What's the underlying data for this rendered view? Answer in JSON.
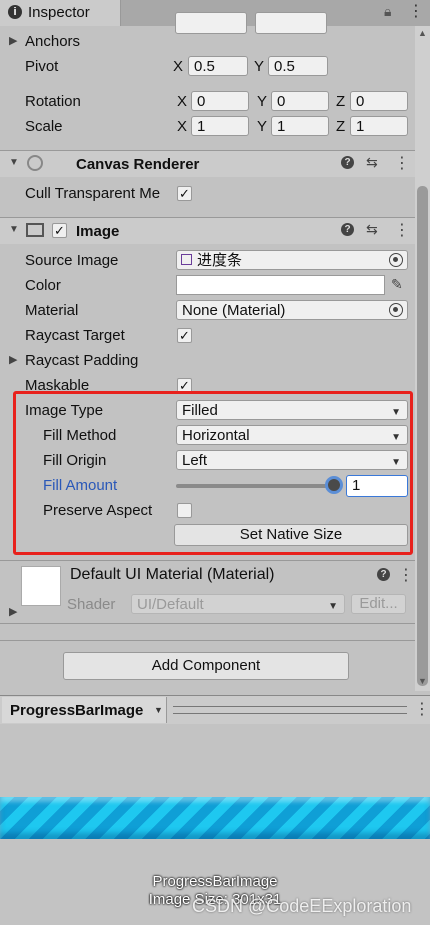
{
  "tab": {
    "title": "Inspector",
    "icons": [
      "lock-icon",
      "menu-icon"
    ]
  },
  "transform": {
    "anchors_label": "Anchors",
    "pivot_label": "Pivot",
    "pivot_x": "0.5",
    "pivot_y": "0.5",
    "rotation_label": "Rotation",
    "rot_x": "0",
    "rot_y": "0",
    "rot_z": "0",
    "scale_label": "Scale",
    "scale_x": "1",
    "scale_y": "1",
    "scale_z": "1",
    "x": "X",
    "y": "Y",
    "z": "Z"
  },
  "canvas_renderer": {
    "title": "Canvas Renderer",
    "cull_label": "Cull Transparent Me",
    "cull_checked": true
  },
  "image": {
    "title": "Image",
    "enabled": true,
    "source_image_label": "Source Image",
    "source_image_value": "进度条",
    "color_label": "Color",
    "material_label": "Material",
    "material_value": "None (Material)",
    "raycast_target_label": "Raycast Target",
    "raycast_padding_label": "Raycast Padding",
    "maskable_label": "Maskable",
    "image_type_label": "Image Type",
    "image_type_value": "Filled",
    "fill_method_label": "Fill Method",
    "fill_method_value": "Horizontal",
    "fill_origin_label": "Fill Origin",
    "fill_origin_value": "Left",
    "fill_amount_label": "Fill Amount",
    "fill_amount_value": "1",
    "fill_amount_fraction": 1.0,
    "preserve_aspect_label": "Preserve Aspect",
    "set_native_size_label": "Set Native Size"
  },
  "material_block": {
    "title": "Default UI Material (Material)",
    "shader_label": "Shader",
    "shader_value": "UI/Default",
    "edit_label": "Edit..."
  },
  "add_component_label": "Add Component",
  "preview": {
    "title": "ProgressBarImage",
    "caption_line1": "ProgressBarImage",
    "caption_line2": "Image Size: 301x31",
    "watermark": "CSDN @CodeEExploration",
    "bar_color": "#1ec8f0"
  },
  "colors": {
    "accent_red": "#e8211c",
    "fill_amount_blue": "#2a58b8"
  }
}
